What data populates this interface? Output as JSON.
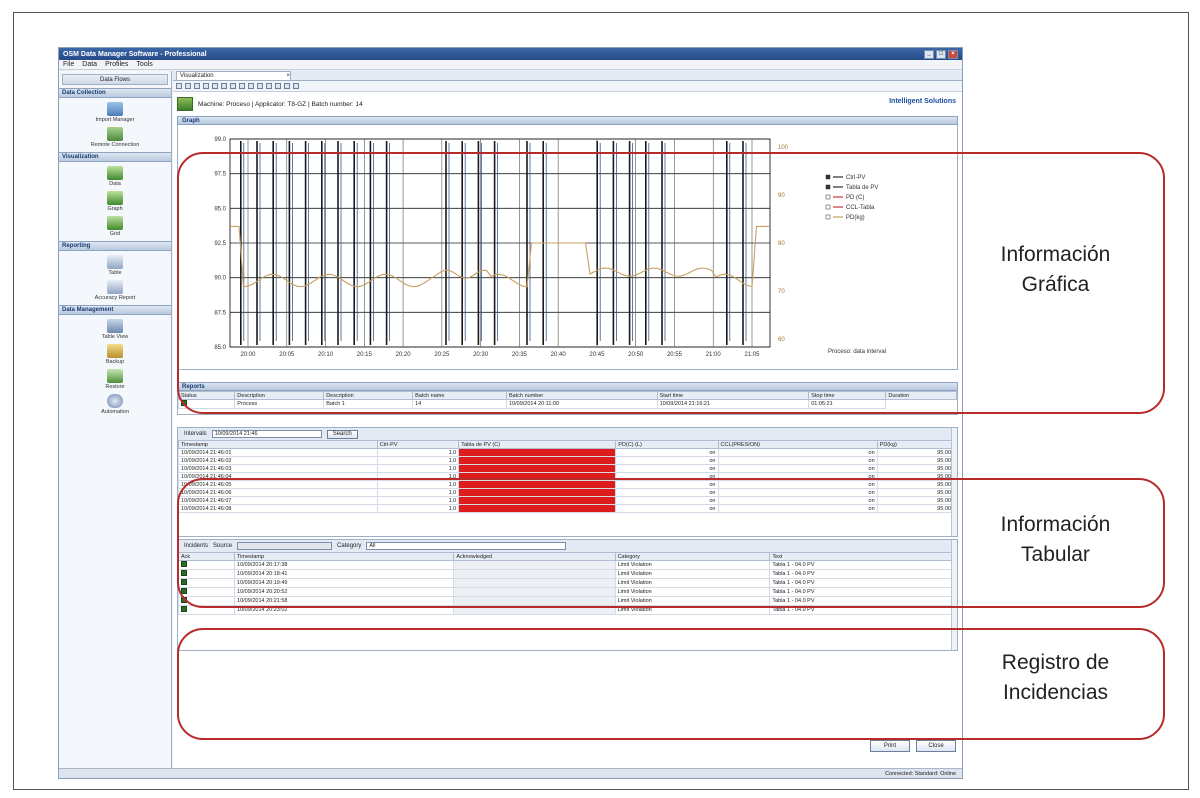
{
  "app": {
    "title": "OSM Data Manager Software - Professional",
    "menu": [
      "File",
      "Data",
      "Profiles",
      "Tools"
    ]
  },
  "sidebar": {
    "head": "Data Flows",
    "sections": [
      {
        "label": "Data Collection",
        "items": [
          "Import Manager",
          "Remote Connection"
        ]
      },
      {
        "label": "Visualization",
        "items": [
          "Data",
          "Graph",
          "Grid"
        ]
      },
      {
        "label": "Reporting",
        "items": [
          "Table",
          "Accuracy Report"
        ]
      },
      {
        "label": "Data Management",
        "items": [
          "Table View",
          "Backup",
          "Restore",
          "Automation"
        ]
      }
    ]
  },
  "document": {
    "tab_label": "Visualization",
    "close": "×",
    "header": "Machine: Proceso | Applicator: T8-GZ | Batch number: 14",
    "brand": "Intelligent Solutions",
    "graph_title": "Graph",
    "reports_title": "Reports",
    "table_tab": "Intervals",
    "interval_value": "10/09/2014 21:46",
    "search_btn": "Search",
    "incidents_tab": "Incidents",
    "category_label": "Category",
    "category_value": "All",
    "cause_label": "Source"
  },
  "chart_data": {
    "type": "line",
    "series": [
      {
        "name": "Ctrl-PV",
        "color": "#2a2a2a"
      },
      {
        "name": "Tabla de PV",
        "color": "#2a2a2a"
      },
      {
        "name": "PD (C)",
        "color": "#c33"
      },
      {
        "name": "CCL-Tabla",
        "color": "#c33"
      },
      {
        "name": "PD(kg)",
        "color": "#c8a060"
      }
    ],
    "x_ticks": [
      "20:00",
      "20:05",
      "20:10",
      "20:15",
      "20:20",
      "20:25",
      "20:30",
      "20:35",
      "20:40",
      "20:45",
      "20:50",
      "20:55",
      "21:00",
      "21:05"
    ],
    "y_ticks": [
      "99.0",
      "97.5",
      "95.0",
      "92.5",
      "90.0",
      "87.5",
      "85.0"
    ],
    "y2_ticks": [
      "100",
      "90",
      "80",
      "70",
      "60"
    ],
    "footnote": "Proceso: data interval",
    "grid": true,
    "legend": "right"
  },
  "reports_table": {
    "columns": [
      "Status",
      "Description",
      "Description",
      "Batch name",
      "Batch number",
      "Start time",
      "Stop time",
      "Duration"
    ],
    "row": [
      "",
      "Process",
      "Batch 1",
      "14",
      "10/09/2014 20:11:00",
      "10/09/2014 21:16:21",
      "01:05:21"
    ]
  },
  "data_table": {
    "columns": [
      "Timestamp",
      "Ctrl-PV",
      "Tabla de PV (C)",
      "PD(C) (L)",
      "CCL(PRESION)",
      "PD(kg)"
    ],
    "rows": [
      [
        "10/09/2014 21:46:01",
        "1.0",
        "",
        "on",
        "on",
        "95.000"
      ],
      [
        "10/09/2014 21:46:02",
        "1.0",
        "",
        "on",
        "on",
        "95.000"
      ],
      [
        "10/09/2014 21:46:03",
        "1.0",
        "",
        "on",
        "on",
        "95.000"
      ],
      [
        "10/09/2014 21:46:04",
        "1.0",
        "",
        "on",
        "on",
        "95.000"
      ],
      [
        "10/09/2014 21:46:05",
        "1.0",
        "",
        "on",
        "on",
        "95.000"
      ],
      [
        "10/09/2014 21:46:06",
        "1.0",
        "",
        "on",
        "on",
        "95.000"
      ],
      [
        "10/09/2014 21:46:07",
        "1.0",
        "",
        "on",
        "on",
        "95.000"
      ],
      [
        "10/09/2014 21:46:08",
        "1.0",
        "",
        "on",
        "on",
        "95.000"
      ]
    ]
  },
  "incidents_table": {
    "columns": [
      "Ack",
      "Timestamp",
      "Acknowledged",
      "Category",
      "Text"
    ],
    "rows": [
      [
        "",
        "10/09/2014 20:17:38",
        "",
        "Limit Violation",
        "Tabla 1 - 04.0 PV"
      ],
      [
        "",
        "10/09/2014 20:18:41",
        "",
        "Limit Violation",
        "Tabla 1 - 04.0 PV"
      ],
      [
        "",
        "10/09/2014 20:19:49",
        "",
        "Limit Violation",
        "Tabla 1 - 04.0 PV"
      ],
      [
        "",
        "10/09/2014 20:20:52",
        "",
        "Limit Violation",
        "Tabla 1 - 04.0 PV"
      ],
      [
        "",
        "10/09/2014 20:21:58",
        "",
        "Limit Violation",
        "Tabla 1 - 04.0 PV"
      ],
      [
        "",
        "10/09/2014 20:23:02",
        "",
        "Limit Violation",
        "Tabla 1 - 04.0 PV"
      ]
    ]
  },
  "footer": {
    "print": "Print",
    "close": "Close",
    "status": "Connected: Standard: Online"
  },
  "annotations": {
    "graphic": [
      "Información",
      "Gráfica"
    ],
    "tabular": [
      "Información",
      "Tabular"
    ],
    "incidents": [
      "Registro de",
      "Incidencias"
    ]
  }
}
